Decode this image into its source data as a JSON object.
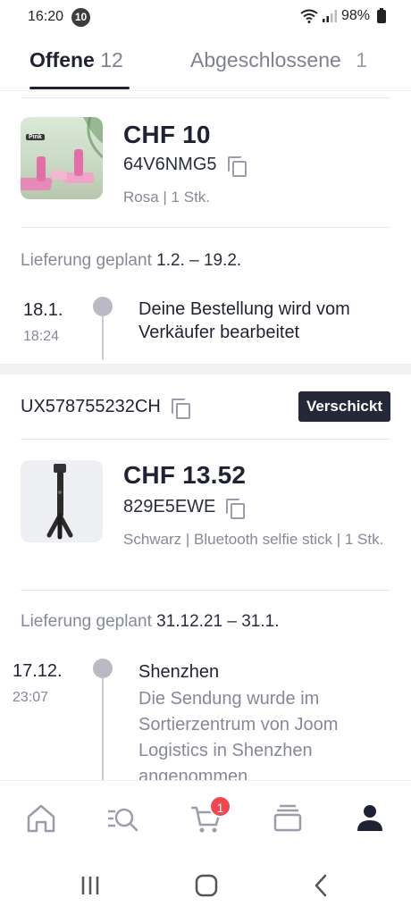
{
  "status_bar": {
    "time": "16:20",
    "notification_count": "10",
    "battery": "98%"
  },
  "tabs": [
    {
      "label": "Offene",
      "count": "12"
    },
    {
      "label": "Abgeschlossene",
      "count": "1"
    }
  ],
  "orders": [
    {
      "price": "CHF 10",
      "code": "64V6NMG5",
      "variant": "Rosa | 1 Stk.",
      "thumb_label": "Pink",
      "delivery_label": "Lieferung geplant",
      "delivery_dates": "1.2. – 19.2.",
      "timeline": [
        {
          "date": "18.1.",
          "time": "18:24",
          "text": "Deine Bestellung wird vom Verkäufer bearbeitet"
        }
      ]
    },
    {
      "tracking": "UX578755232CH",
      "status_badge": "Verschickt",
      "price": "CHF 13.52",
      "code": "829E5EWE",
      "variant": "Schwarz | Bluetooth selfie stick | 1 Stk.",
      "delivery_label": "Lieferung geplant",
      "delivery_dates": "31.12.21 – 31.1.",
      "timeline": [
        {
          "date": "17.12.",
          "time": "23:07",
          "title": "Shenzhen",
          "text": "Die Sendung wurde im Sortierzentrum von Joom Logistics in Shenzhen angenommen"
        }
      ]
    }
  ],
  "bottom_nav": {
    "items": [
      "home-icon",
      "search-icon",
      "cart-icon",
      "orders-icon",
      "profile-icon"
    ],
    "cart_count": "1"
  },
  "colors": {
    "primary": "#1f2233",
    "badge_red": "#ef4650",
    "muted": "#858998"
  }
}
